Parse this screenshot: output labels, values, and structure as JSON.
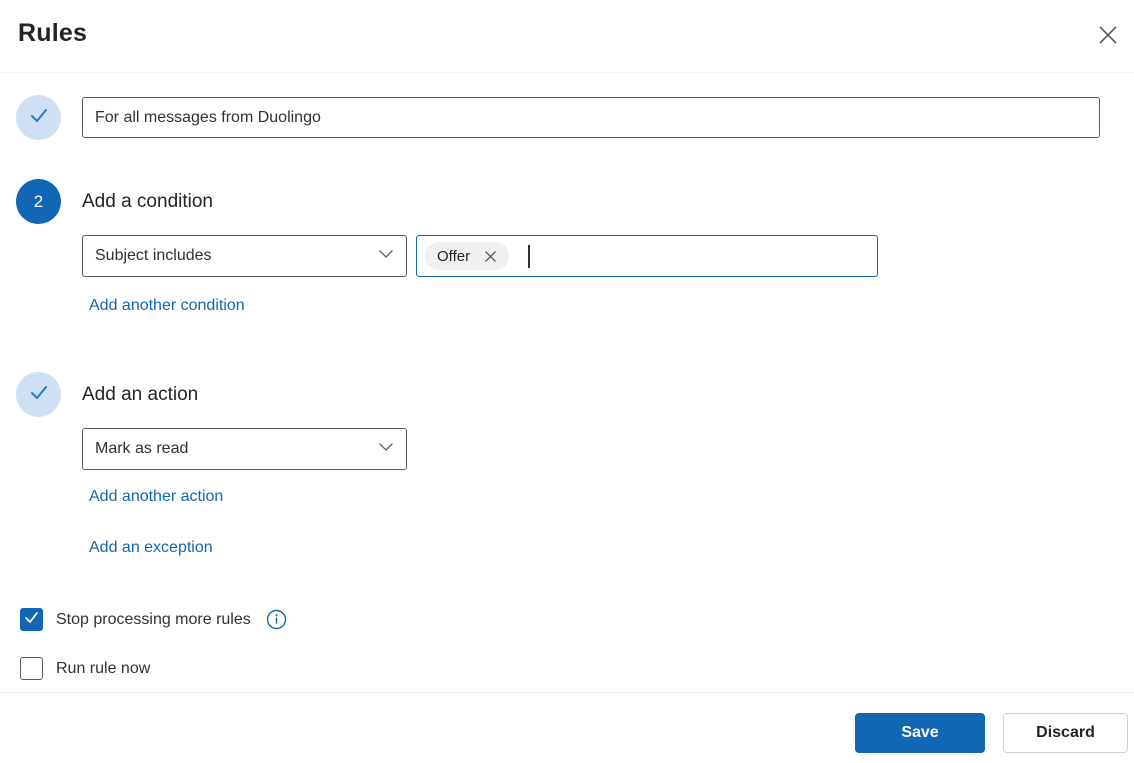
{
  "header": {
    "title": "Rules"
  },
  "rule_name": {
    "value": "For all messages from Duolingo"
  },
  "condition_step": {
    "number": "2",
    "heading": "Add a condition",
    "select_value": "Subject includes",
    "tag_label": "Offer",
    "add_link": "Add another condition"
  },
  "action_step": {
    "heading": "Add an action",
    "select_value": "Mark as read",
    "add_link": "Add another action",
    "exception_link": "Add an exception"
  },
  "options": {
    "stop_processing": {
      "label": "Stop processing more rules",
      "checked": true
    },
    "run_now": {
      "label": "Run rule now",
      "checked": false
    }
  },
  "footer": {
    "save_label": "Save",
    "discard_label": "Discard"
  },
  "colors": {
    "primary_blue": "#1267b4",
    "light_circle_blue": "#cfe0f5",
    "check_blue": "#2779cb",
    "link_blue": "#1267b4",
    "border_gray": "#605e5c",
    "divider_gray": "#f0f0f0"
  }
}
